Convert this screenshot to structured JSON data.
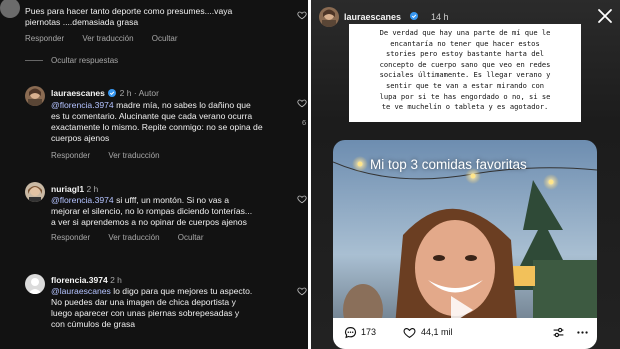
{
  "left": {
    "top_comment": {
      "text_lines": [
        "Pues para hacer tanto deporte como presumes....vaya",
        "piernotas ....demasiada grasa"
      ],
      "actions": [
        "Responder",
        "Ver traducción",
        "Ocultar"
      ]
    },
    "hide_replies": "Ocultar respuestas",
    "comments": [
      {
        "username": "laurae scanes",
        "display_username": "lauraescanes",
        "time": "2 h",
        "author_label": "Autor",
        "mention": "@florencia.3974",
        "text_first": " madre mía, no sabes lo dañino que",
        "text_lines": [
          "es tu comentario. Alucinante que cada verano ocurra",
          "exactamente lo mismo. Repite conmigo: no se opina de",
          "cuerpos ajenos"
        ],
        "actions": [
          "Responder",
          "Ver traducción"
        ],
        "likes": "6"
      },
      {
        "display_username": "nuriagl1",
        "time": "2 h",
        "mention": "@florencia.3974",
        "text_first": " si ufff, un montón. Si no vas a",
        "text_lines": [
          "mejorar el silencio, no lo rompas diciendo tonterías...",
          "a ver si aprendemos a no opinar de cuerpos ajenos"
        ],
        "actions": [
          "Responder",
          "Ver traducción",
          "Ocultar"
        ]
      },
      {
        "display_username": "florencia.3974",
        "time": "2 h",
        "mention": "@lauraescanes",
        "text_first": " lo digo para que mejores tu aspecto.",
        "text_lines": [
          "No puedes dar una imagen de chica deportista y",
          "luego aparecer con unas piernas sobrepesadas y",
          "con cúmulos de grasa"
        ]
      }
    ]
  },
  "story": {
    "username": "lauraescanes",
    "time": "14 h",
    "text_lines": [
      "De verdad que hay una parte de mí que le",
      "encantaría no tener que hacer estos",
      "stories pero estoy bastante harta del",
      "concepto de cuerpo sano que veo en redes",
      "sociales últimamente. Es llegar verano y",
      "sentir que te van a estar mirando con",
      "lupa por si te has engordado o no, si se",
      "te ve muchelín o tableta y es agotador."
    ],
    "photo_title": "Mi top 3 comidas favoritas",
    "comments_count": "173",
    "likes_count": "44,1 mil"
  },
  "colors": {
    "mention": "#b4c3ff",
    "verified": "#3897f0",
    "background": "#121212"
  }
}
